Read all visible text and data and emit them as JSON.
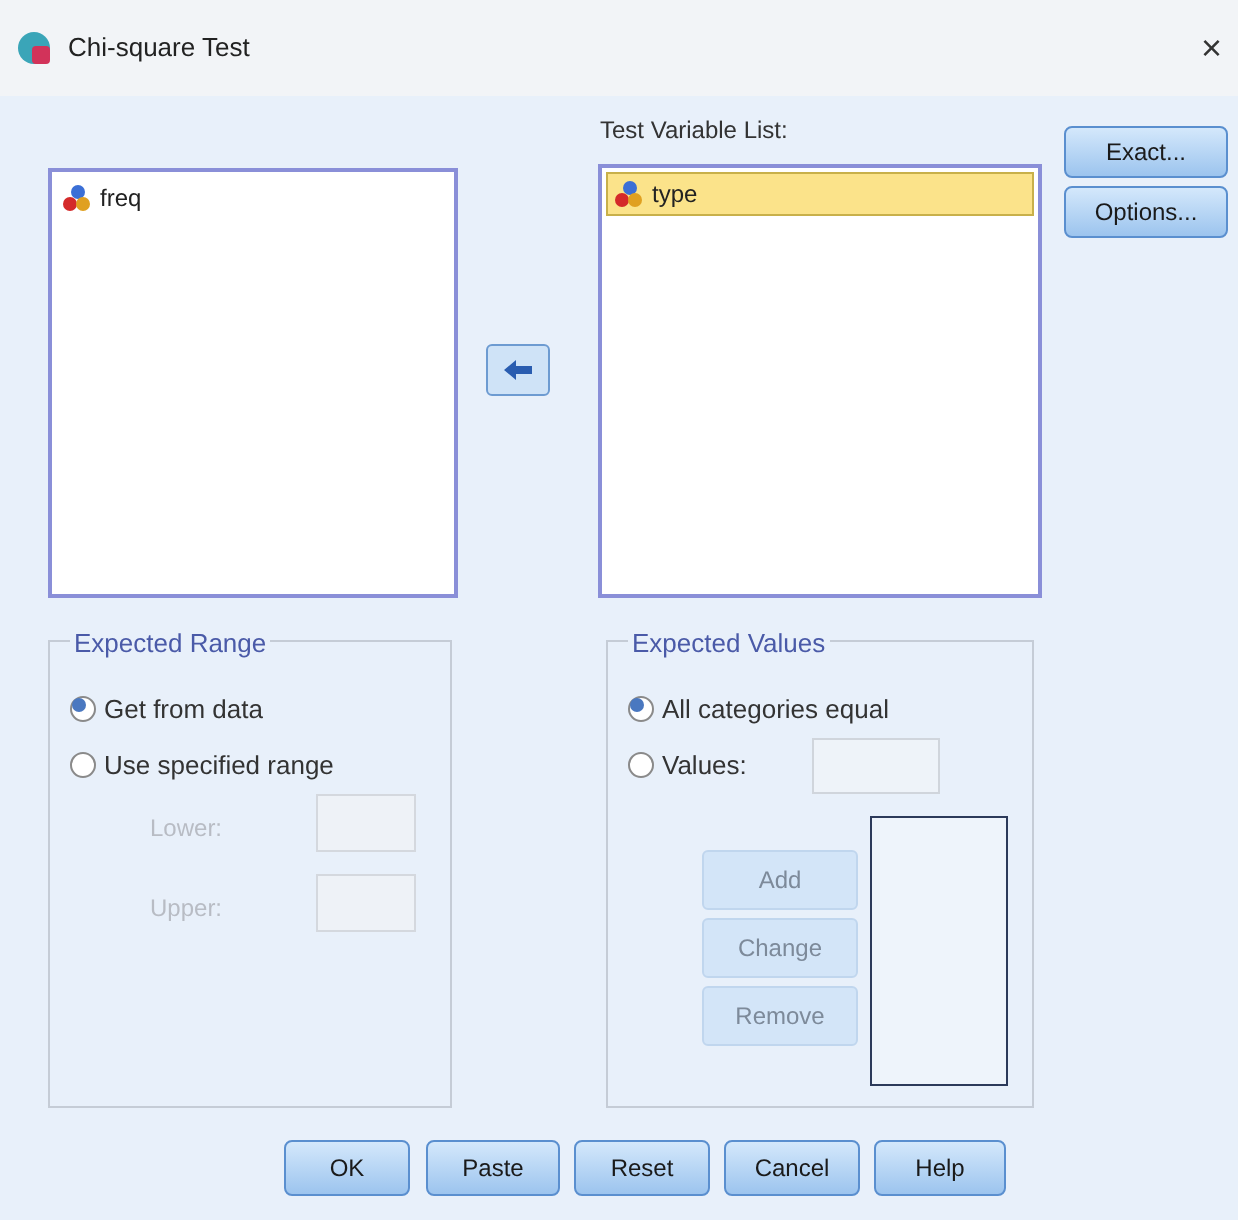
{
  "window": {
    "title": "Chi-square Test",
    "close": "×"
  },
  "source_list": {
    "items": [
      {
        "label": "freq",
        "selected": false
      }
    ]
  },
  "test_variable_list": {
    "label": "Test Variable List:",
    "items": [
      {
        "label": "type",
        "selected": true
      }
    ]
  },
  "side_buttons": [
    {
      "label": "Exact..."
    },
    {
      "label": "Options..."
    }
  ],
  "expected_range": {
    "title": "Expected Range",
    "options": [
      {
        "label": "Get from data",
        "selected": true
      },
      {
        "label": "Use specified range",
        "selected": false
      }
    ],
    "fields": [
      {
        "label": "Lower:",
        "disabled": true
      },
      {
        "label": "Upper:",
        "disabled": true
      }
    ]
  },
  "expected_values": {
    "title": "Expected Values",
    "options": [
      {
        "label": "All categories equal",
        "selected": true
      },
      {
        "label": "Values:",
        "selected": false
      }
    ],
    "buttons": [
      {
        "label": "Add",
        "disabled": true
      },
      {
        "label": "Change",
        "disabled": true
      },
      {
        "label": "Remove",
        "disabled": true
      }
    ]
  },
  "buttons": [
    {
      "label": "OK"
    },
    {
      "label": "Paste"
    },
    {
      "label": "Reset"
    },
    {
      "label": "Cancel"
    },
    {
      "label": "Help"
    }
  ]
}
